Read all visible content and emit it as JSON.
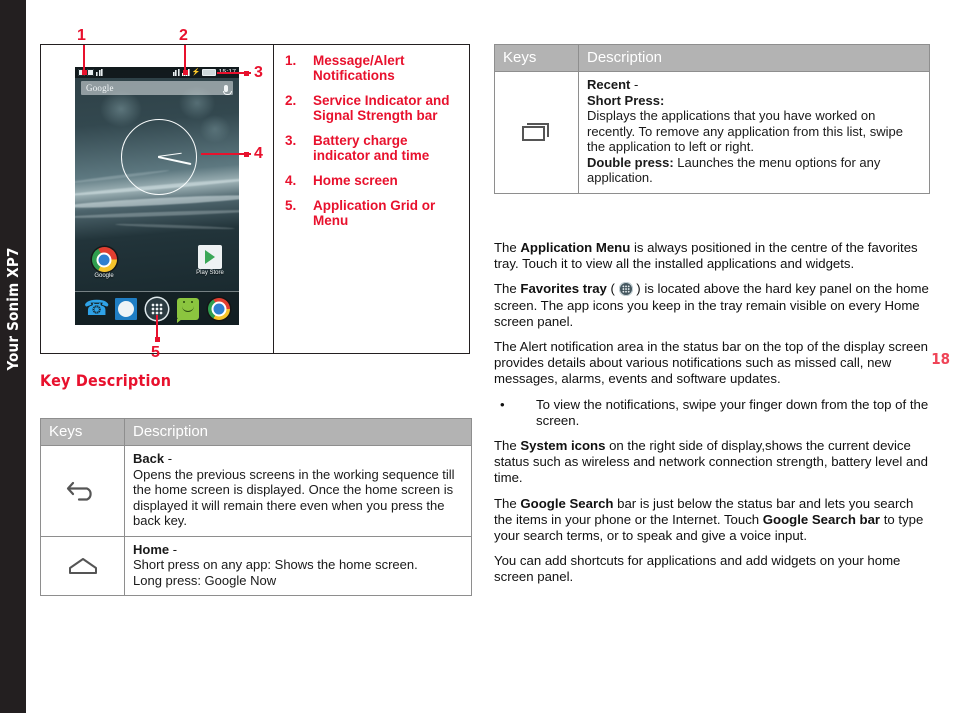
{
  "spine": {
    "label": "Your Sonim XP7"
  },
  "page_number": "18",
  "figure": {
    "callouts": [
      {
        "number": "1",
        "target": "Message/Alert Notifications"
      },
      {
        "number": "2",
        "target": "Service Indicator and Signal Strength bar"
      },
      {
        "number": "3",
        "target": "Battery charge indicator and time"
      },
      {
        "number": "4",
        "target": "Home screen"
      },
      {
        "number": "5",
        "target": "Application Grid or Menu"
      }
    ],
    "legend": [
      {
        "num": "1.",
        "text": "Message/Alert Notifications"
      },
      {
        "num": "2.",
        "text": "Service Indicator and Signal Strength bar"
      },
      {
        "num": "3.",
        "text": "Battery charge indicator and time"
      },
      {
        "num": "4.",
        "text": "Home screen"
      },
      {
        "num": "5.",
        "text": "Application Grid or Menu"
      }
    ],
    "phone": {
      "status_time": "15:17",
      "battery_label": "92%",
      "search_placeholder": "Google",
      "shortcuts": [
        {
          "label": "Google"
        },
        {
          "label": "Play Store"
        }
      ]
    }
  },
  "section_heading": "Key Description",
  "table_left": {
    "headers": [
      "Keys",
      "Description"
    ],
    "rows": [
      {
        "icon": "back-arrow-icon",
        "title": "Back",
        "dash": " -",
        "body": "Opens the previous screens in the working sequence till the home screen is displayed. Once the home screen is displayed it will remain there even when you press the back key."
      },
      {
        "icon": "home-icon",
        "title": "Home",
        "dash": " -",
        "line1": "Short press on any app: Shows the home screen.",
        "line2": "Long press: Google Now"
      }
    ]
  },
  "table_right": {
    "headers": [
      "Keys",
      "Description"
    ],
    "row": {
      "icon": "recent-apps-icon",
      "title": "Recent",
      "dash": " -",
      "subtitle": "Short Press:",
      "body": "Displays the applications that you have worked on recently. To remove any application from this list, swipe the application to left or right.",
      "double_label": "Double press:",
      "double_body": " Launches the menu options for any application."
    }
  },
  "body_right": {
    "p1_a": "The ",
    "p1_b": "Application Menu",
    "p1_c": " is always positioned in the centre of the favorites tray. Touch it to view all the installed applications and widgets.",
    "p2_a": "The ",
    "p2_b": "Favorites tray",
    "p2_c": " ( ",
    "p2_d": " ) is located above the hard key panel on the home screen. The app icons you keep in the tray remain visible on every Home screen panel.",
    "p3": "The Alert notification area in the status bar on the top of the display screen provides details about various notifications such as missed call, new messages, alarms, events and software updates.",
    "bullet_mark": "•",
    "bullet1": "To view the notifications, swipe your finger down from the top of the screen.",
    "p4_a": "The ",
    "p4_b": "System icons",
    "p4_c": " on the right side of  display,shows the current device status such as wireless and network connection strength, battery level and time.",
    "p5_a": "The ",
    "p5_b": "Google Search",
    "p5_c": " bar is just below the status bar and lets you search the items in your phone or the Internet. Touch ",
    "p5_d": "Google Search bar",
    "p5_e": " to type your search terms, or to speak and give a voice input.",
    "p6": "You can add shortcuts for applications and add widgets on your home screen panel."
  },
  "colors": {
    "accent_red": "#e8112d",
    "page_number_red": "#ef4457",
    "table_header_gray": "#b3b3b3",
    "spine_black": "#231f20"
  }
}
